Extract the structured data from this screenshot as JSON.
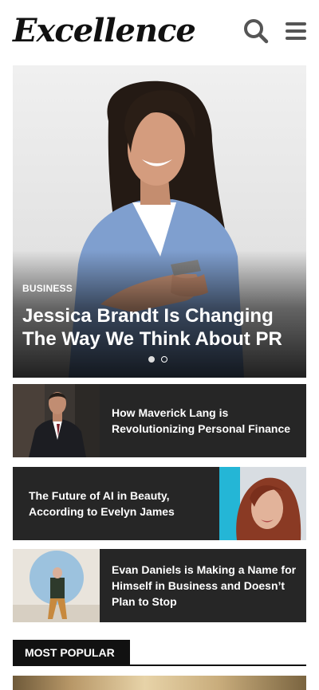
{
  "header": {
    "logo": "Excellence",
    "icons": [
      "search-icon",
      "hamburger-menu-icon"
    ]
  },
  "hero": {
    "category": "BUSINESS",
    "title": "Jessica Brandt Is Changing The Way We Think About PR",
    "slide_count": 2,
    "active_slide": 1
  },
  "articles": [
    {
      "title": "How Maverick Lang is Revolutionizing Personal Finance"
    },
    {
      "title": "The Future of AI in Beauty, According to Evelyn James"
    },
    {
      "title": "Evan Daniels is Making a Name for Himself in Business and Doesn’t Plan to Stop"
    }
  ],
  "most_popular": {
    "label": "MOST POPULAR"
  },
  "colors": {
    "card_bg": "#262626",
    "text_dark": "#111111",
    "white": "#ffffff"
  }
}
